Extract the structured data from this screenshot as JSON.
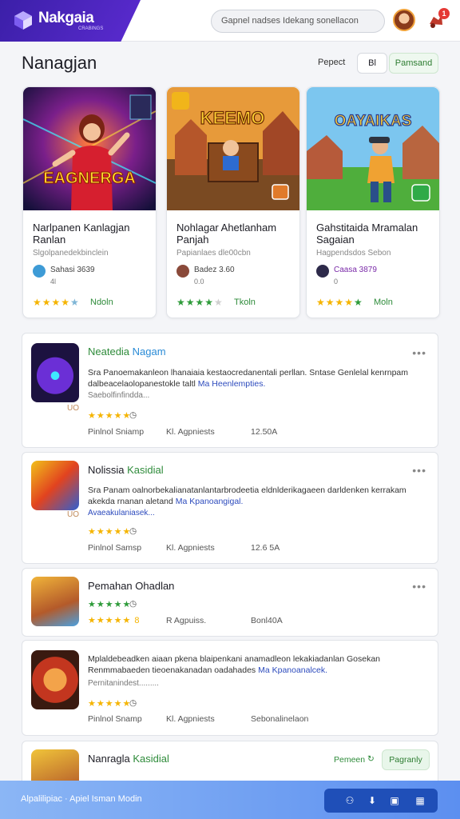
{
  "app": {
    "name": "Nakgaia",
    "tagline": "CRABINGS",
    "notifications": "1"
  },
  "search": {
    "placeholder": "Gapnel nadses Idekang sonellacon"
  },
  "page": {
    "title": "Nanagjan",
    "sort_label": "Pepect",
    "sort_value": "Bl",
    "filter_label": "Pamsand"
  },
  "featured": [
    {
      "art": "EAGNERGA",
      "title": "Narlpanen Kanlagjan Ranlan",
      "subtitle": "Slgolpanedekbinclein",
      "dev": "Sahasi 3639",
      "dev2": "4l",
      "stars": "★★★★★",
      "tag": "Ndoln"
    },
    {
      "art": "KEEMO",
      "title": "Nohlagar Ahetlanham Panjah",
      "subtitle": "Papianlaes dle00cbn",
      "dev": "Badez 3.60",
      "dev2": "0.0",
      "stars": "★★★★★",
      "tag": "Tkoln"
    },
    {
      "art": "OAYAIKAS",
      "title": "Gahstitaida Mramalan Sagaian",
      "subtitle": "Hagpendsdos Sebon",
      "dev": "Caasa 3879",
      "dev2": "0",
      "stars": "★★★★★",
      "tag": "Moln"
    }
  ],
  "list": [
    {
      "title_a": "Neatedia",
      "title_b": "Nagam",
      "desc": "Sra Panoemakanleon lhanaiaia kestaocredanentali perllan. Sntase Genlelal kenrnpam dalbeacelaolopanestokle taltl",
      "link": "Ma Heenlempties.",
      "more": "Saebolfinfindda...",
      "stars": "★★★★★",
      "meta": [
        "Pinlnol Sniamp",
        "Kl. Agpniests",
        "12.50A"
      ],
      "badge": "UO"
    },
    {
      "title_a": "Nolissia",
      "title_b": "Kasidial",
      "desc": "Sra Panam oalnorbekalianatanlantarbrodeetia eldnlderikagaeen darldenken kerrakam akekda rnanan aletand",
      "link": "Ma Kpanoangigal.",
      "more": "Avaeakulaniasek...",
      "stars": "★★★★★",
      "meta": [
        "Pinlnol Samsp",
        "Kl. Agpniests",
        "12.6 5A"
      ],
      "badge": "UO"
    },
    {
      "title_a": "Pemahan Ohadlan",
      "title_b": "",
      "desc": "",
      "link": "",
      "more": "",
      "stars": "★★★★★",
      "stars2": "★★★★★ 8",
      "meta": [
        "R Agpuiss.",
        "Bonl40A"
      ],
      "badge": ""
    },
    {
      "title_a": "",
      "title_b": "",
      "desc": "Mplaldebeadken aiaan pkena blaipenkani anamadleon lekakiadanlan Gosekan Renmmabaeden tieoenakanadan oadahades",
      "link": "Ma Kpanoanalcek.",
      "more": "Pernitanindest.........",
      "stars": "★★★★★",
      "meta": [
        "Pinlnol Snamp",
        "Kl. Agpniests",
        "Sebonalinelaon"
      ],
      "badge": ""
    },
    {
      "title_a": "Nanragla",
      "title_b": "Kasidial",
      "action": "Pemeen",
      "button": "Pagranly"
    }
  ],
  "bottom": {
    "text": "Alpalilipiac · Apiel Isman Modin"
  }
}
